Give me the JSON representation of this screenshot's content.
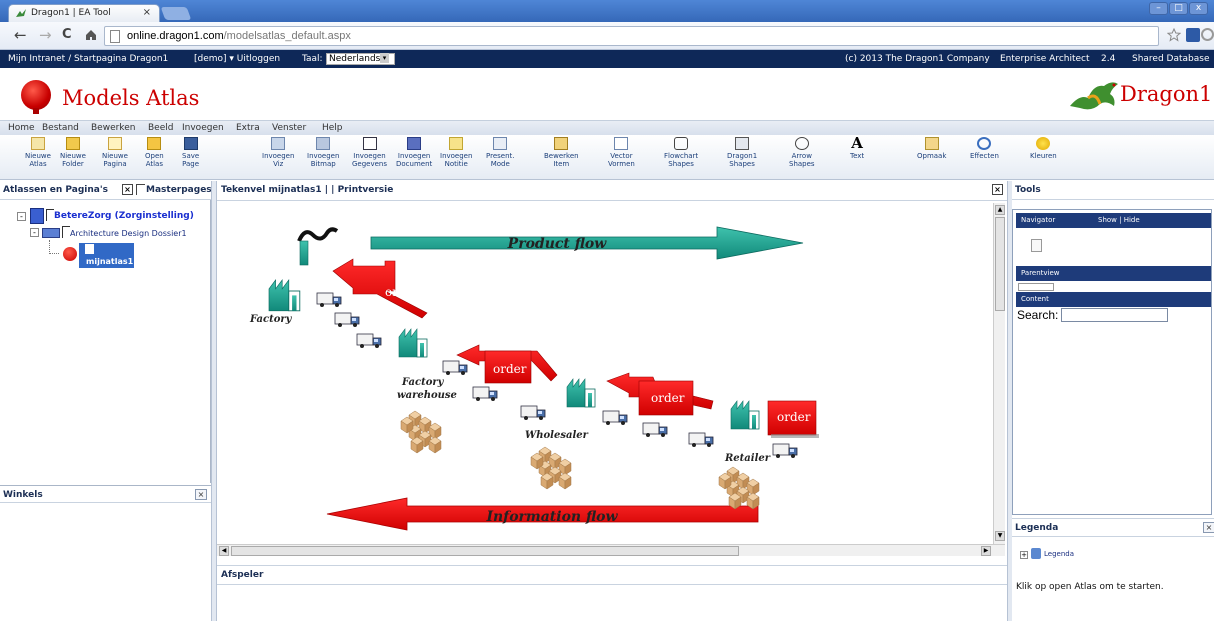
{
  "browser": {
    "tab_title": "Dragon1 | EA Tool",
    "tab_close": "×",
    "url_domain": "online.dragon1.com",
    "url_path": "/modelsatlas_default.aspx"
  },
  "topbar": {
    "intranet": "Mijn Intranet / Startpagina Dragon1",
    "demo": "[demo] ▾ Uitloggen",
    "taal_label": "Taal:",
    "taal_value": "Nederlands",
    "copyright": "(c) 2013 The Dragon1 Company",
    "product": "Enterprise Architect",
    "version": "2.4",
    "database": "Shared Database"
  },
  "header": {
    "title": "Models Atlas",
    "brand": "Dragon1"
  },
  "menu": [
    "Home",
    "Bestand",
    "Bewerken",
    "Beeld",
    "Invoegen",
    "Extra",
    "Venster",
    "Help"
  ],
  "toolbar": [
    {
      "l1": "Nieuwe",
      "l2": "Atlas",
      "icon": "new-atlas-icon"
    },
    {
      "l1": "Nieuwe",
      "l2": "Folder",
      "icon": "new-folder-icon"
    },
    {
      "l1": "Nieuwe",
      "l2": "Pagina",
      "icon": "new-page-icon"
    },
    {
      "l1": "Open",
      "l2": "Atlas",
      "icon": "open-atlas-icon"
    },
    {
      "l1": "Save",
      "l2": "Page",
      "icon": "save-icon"
    },
    {
      "l1": "Invoegen",
      "l2": "Viz",
      "icon": "insert-viz-icon"
    },
    {
      "l1": "Invoegen",
      "l2": "Bitmap",
      "icon": "insert-bitmap-icon"
    },
    {
      "l1": "Invoegen",
      "l2": "Gegevens",
      "icon": "insert-data-icon"
    },
    {
      "l1": "Invoegen",
      "l2": "Document",
      "icon": "insert-document-icon"
    },
    {
      "l1": "Invoegen",
      "l2": "Notitie",
      "icon": "insert-note-icon"
    },
    {
      "l1": "Present.",
      "l2": "Mode",
      "icon": "presentation-icon"
    },
    {
      "l1": "Bewerken",
      "l2": "Item",
      "icon": "edit-item-icon"
    },
    {
      "l1": "Vector",
      "l2": "Vormen",
      "icon": "vector-shapes-icon"
    },
    {
      "l1": "Flowchart",
      "l2": "Shapes",
      "icon": "flowchart-icon"
    },
    {
      "l1": "Dragon1",
      "l2": "Shapes",
      "icon": "dragon1-shapes-icon"
    },
    {
      "l1": "Arrow",
      "l2": "Shapes",
      "icon": "arrow-shapes-icon"
    },
    {
      "l1": "Text",
      "l2": "",
      "icon": "text-icon"
    },
    {
      "l1": "Opmaak",
      "l2": "",
      "icon": "format-icon"
    },
    {
      "l1": "Effecten",
      "l2": "",
      "icon": "effects-icon"
    },
    {
      "l1": "Kleuren",
      "l2": "",
      "icon": "colors-icon"
    }
  ],
  "left": {
    "title": "Atlassen en Pagina's",
    "masterpages": "Masterpages",
    "tree": {
      "root": "BetereZorg (Zorginstelling)",
      "child": "Architecture Design Dossier1",
      "leaf": "mijnatlas1"
    },
    "winkels": "Winkels"
  },
  "canvas": {
    "header": "Tekenvel mijnatlas1 |  | Printversie",
    "labels": {
      "product_flow": "Product flow",
      "information_flow": "Information flow",
      "order": "order",
      "factory": "Factory",
      "factory_warehouse_1": "Factory",
      "factory_warehouse_2": "warehouse",
      "wholesaler": "Wholesaler",
      "retailer": "Retailer"
    },
    "afspeler": "Afspeler"
  },
  "tools": {
    "title": "Tools",
    "navigator": "Navigator",
    "show_hide": "Show | Hide",
    "parentview": "Parentview",
    "content": "Content",
    "search_label": "Search:",
    "search_value": ""
  },
  "legenda": {
    "title": "Legenda",
    "item": "Legenda",
    "hint": "Klik op open Atlas om te starten."
  },
  "colors": {
    "accent_dark": "#0e2858",
    "arrow_teal": "#1f9e8e",
    "arrow_red": "#e80000",
    "brand_red": "#cc0000"
  }
}
